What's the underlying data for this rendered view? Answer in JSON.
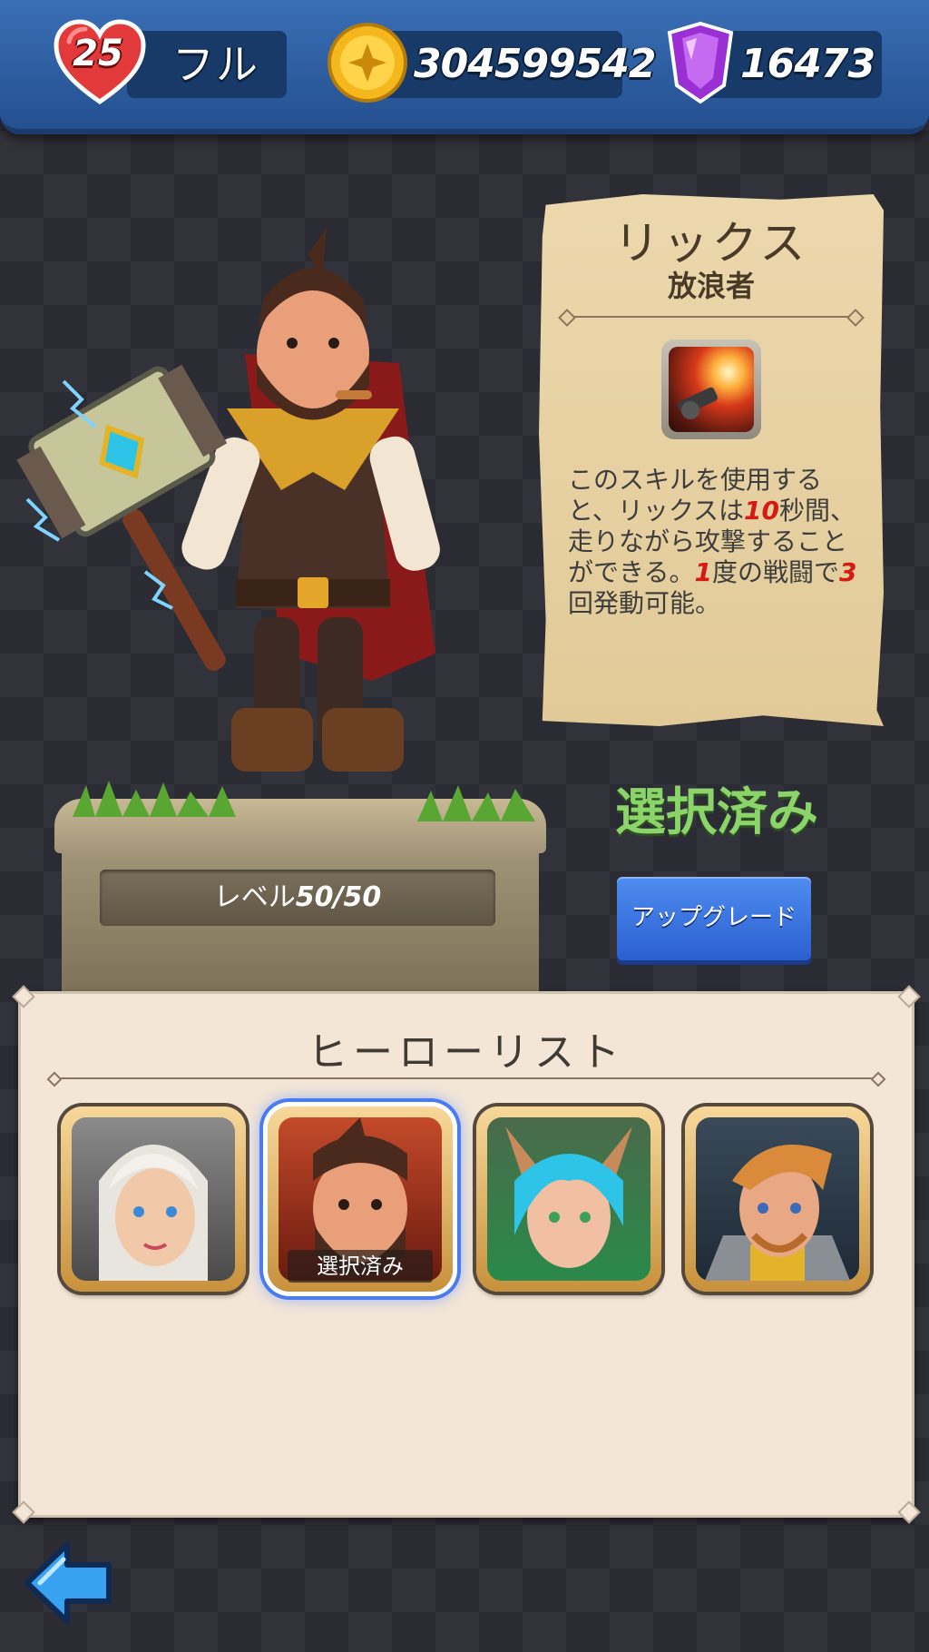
{
  "resources": {
    "lives_count": "25",
    "lives_status": "フル",
    "coins": "304599542",
    "gems": "16473"
  },
  "hero": {
    "name": "リックス",
    "class": "放浪者",
    "level_label": "レベル",
    "level_value": "50/50",
    "skill": {
      "icon": "gun-fire-skill-icon",
      "desc_1": "このスキルを使用すると、リックスは",
      "duration": "10",
      "desc_2": "秒間、走りながら攻撃することができる。",
      "battles": "1",
      "desc_3": "度の戦闘で",
      "uses": "3",
      "desc_4": "回発動可能。"
    },
    "status_label": "選択済み",
    "upgrade_label": "アップグレード"
  },
  "hero_list": {
    "title": "ヒーローリスト",
    "selected_badge": "選択済み",
    "selected_index": 1
  },
  "colors": {
    "topbar": "#2f62a8",
    "selected_green": "#8bd46a",
    "upgrade_blue": "#3a74e0",
    "highlight_red": "#d51a14"
  }
}
